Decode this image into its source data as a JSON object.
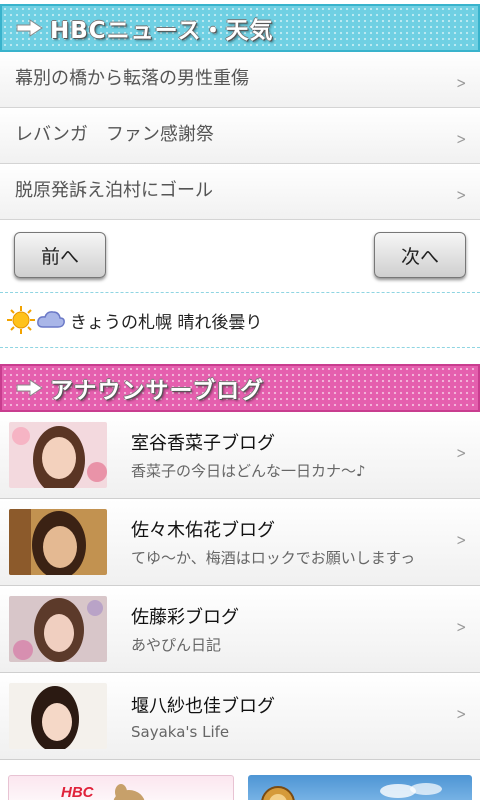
{
  "news_header": {
    "title": "HBCニュース・天気",
    "icon": "arrow-right-icon"
  },
  "news": [
    {
      "title": "幕別の橋から転落の男性重傷"
    },
    {
      "title": "レバンガ　ファン感謝祭"
    },
    {
      "title": "脱原発訴え泊村にゴール"
    }
  ],
  "pager": {
    "prev": "前へ",
    "next": "次へ"
  },
  "weather": {
    "text": "きょうの札幌 晴れ後曇り",
    "icons": [
      "sun-icon",
      "cloud-icon"
    ]
  },
  "blog_header": {
    "title": "アナウンサーブログ",
    "icon": "arrow-right-icon"
  },
  "blogs": [
    {
      "title": "室谷香菜子ブログ",
      "subtitle": "香菜子の今日はどんな一日カナ～♪"
    },
    {
      "title": "佐々木佑花ブログ",
      "subtitle": "てゆ～か、梅酒はロックでお願いしますっ"
    },
    {
      "title": "佐藤彩ブログ",
      "subtitle": "あやぴん日記"
    },
    {
      "title": "堰八紗也佳ブログ",
      "subtitle": "Sayaka's Life"
    }
  ],
  "chevron": ">",
  "banners": {
    "left_label": "HBC"
  },
  "colors": {
    "news_header": "#6fd0e3",
    "blog_header": "#e55fae",
    "divider": "#8fd5e2"
  }
}
